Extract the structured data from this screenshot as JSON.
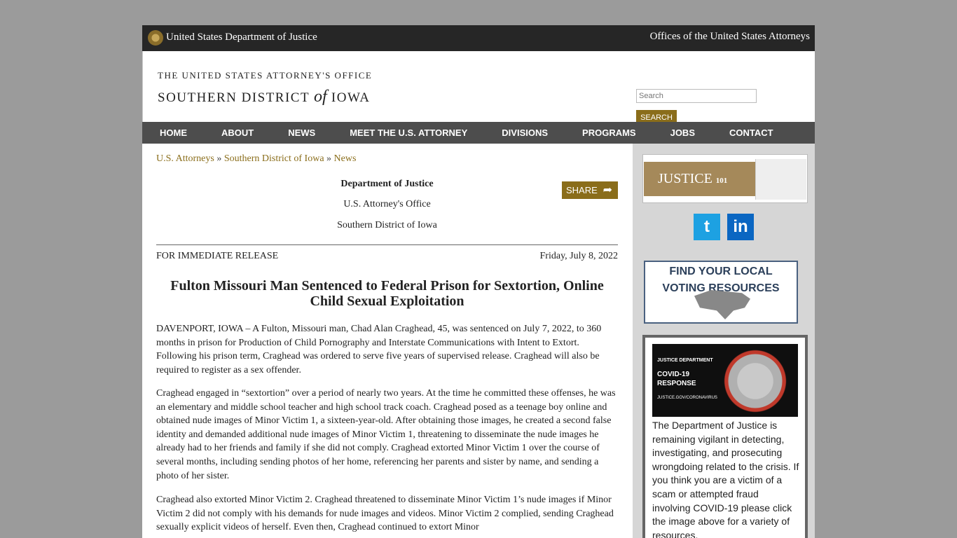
{
  "topbar": {
    "agency": "United States Department of Justice",
    "offices": "Offices of the United States Attorneys"
  },
  "header": {
    "logo_line1": "THE UNITED STATES ATTORNEY'S OFFICE",
    "logo_line2_a": "SOUTHERN DISTRICT",
    "logo_line2_of": "of",
    "logo_line2_b": "IOWA",
    "search_placeholder": "Search",
    "search_button": "SEARCH"
  },
  "nav": [
    "HOME",
    "ABOUT",
    "NEWS",
    "MEET THE U.S. ATTORNEY",
    "DIVISIONS",
    "PROGRAMS",
    "JOBS",
    "CONTACT"
  ],
  "breadcrumb": {
    "items": [
      "U.S. Attorneys",
      "Southern District of Iowa",
      "News"
    ],
    "sep": "»"
  },
  "press": {
    "dept": "Department of Justice",
    "office": "U.S. Attorney's Office",
    "district": "Southern District of Iowa",
    "share": "SHARE",
    "release": "FOR IMMEDIATE RELEASE",
    "date": "Friday, July 8, 2022",
    "title": "Fulton Missouri Man Sentenced to Federal Prison for Sextortion, Online Child Sexual Exploitation",
    "paragraphs": [
      "DAVENPORT, IOWA – A Fulton, Missouri man, Chad Alan Craghead, 45, was sentenced on July 7, 2022, to 360 months in prison for Production of Child Pornography and Interstate Communications with Intent to Extort. Following his prison term, Craghead was ordered to serve five years of supervised release. Craghead will also be required to register as a sex offender.",
      "Craghead engaged in “sextortion” over a period of nearly two years. At the time he committed these offenses, he was an elementary and middle school teacher and high school track coach. Craghead posed as a teenage boy online and obtained nude images of Minor Victim 1, a sixteen-year-old. After obtaining those images, he created a second false identity and demanded additional nude images of Minor Victim 1, threatening to disseminate the nude images he already had to her friends and family if she did not comply. Craghead extorted Minor Victim 1 over the course of several months, including sending photos of her home, referencing her parents and sister by name, and sending a photo of her sister.",
      "Craghead also extorted Minor Victim 2. Craghead threatened to disseminate Minor Victim 1’s nude images if Minor Victim 2 did not comply with his demands for nude images and videos. Minor Victim 2 complied, sending Craghead sexually explicit videos of herself. Even then, Craghead continued to extort Minor"
    ]
  },
  "sidebar": {
    "justice101": "JUSTICE",
    "justice101_num": "101",
    "twitter": "t",
    "linkedin": "in",
    "vote_line1": "FIND YOUR LOCAL",
    "vote_line2": "VOTING RESOURCES",
    "covid_l1": "JUSTICE DEPARTMENT",
    "covid_l2": "COVID-19",
    "covid_l3": "RESPONSE",
    "covid_l4": "JUSTICE.GOV/CORONAVIRUS",
    "covid_text": "The Department of Justice is remaining vigilant in detecting, investigating, and prosecuting wrongdoing related to the crisis. If you think you are a victim of a scam or attempted fraud involving COVID-19 please click the image above for a variety of resources."
  }
}
